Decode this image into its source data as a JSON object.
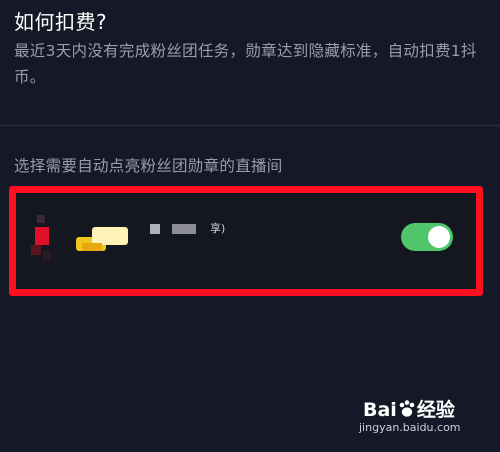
{
  "faq": {
    "title": "如何扣费?",
    "description": "最近3天内没有完成粉丝团任务，勋章达到隐藏标准，自动扣费1抖币。"
  },
  "section": {
    "label": "选择需要自动点亮粉丝团勋章的直播间"
  },
  "live_room": {
    "name_suffix": "享)",
    "auto_light_enabled": true
  },
  "colors": {
    "background": "#151826",
    "highlight": "#ff0f1f",
    "toggle_on": "#4fc56c"
  },
  "watermark": {
    "logo_text_1": "Bai",
    "logo_text_2": "经验",
    "url": "jingyan.baidu.com"
  }
}
